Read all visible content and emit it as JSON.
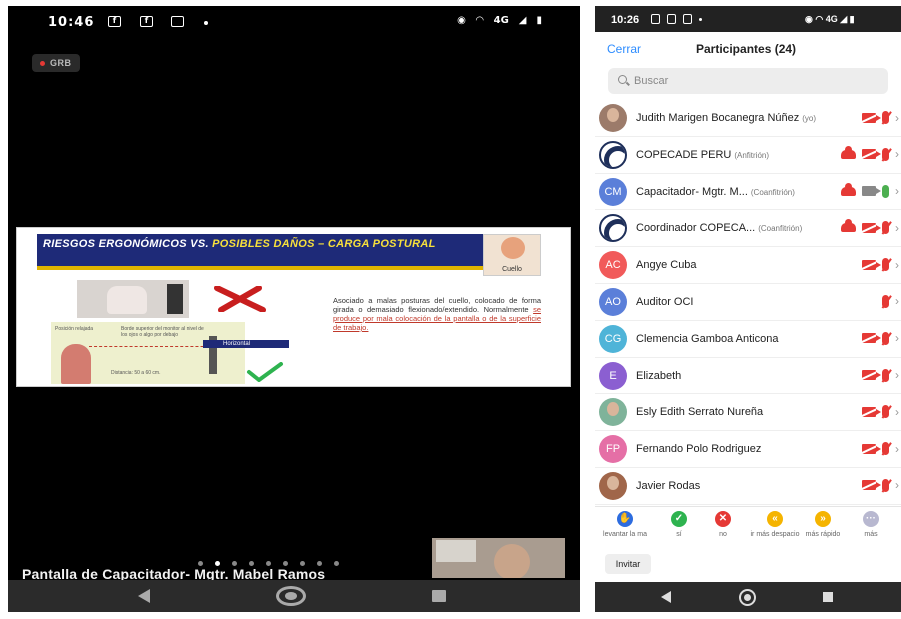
{
  "left_screen": {
    "status_bar": {
      "time": "10:46",
      "indicators": "4G"
    },
    "recording_badge": "GRB",
    "slide": {
      "title_part1": "RIESGOS ERGONÓMICOS VS. ",
      "title_part2": "POSIBLES DAÑOS – CARGA POSTURAL",
      "neck_label": "Cuello",
      "horizontal_label": "Horizontal",
      "distance_label": "Distancia: 50 a 60 cm.",
      "posicion_label": "Posición relajada",
      "borde_label": "Borde superior del monitor al nivel de los ojos o algo por debajo",
      "body_text": "Asociado a malas posturas del cuello, colocado de forma girada o demasiado flexionado/extendido. Normalmente ",
      "body_text_underlined": "se produce por mala colocación de la pantalla o de la superficie de trabajo."
    },
    "page_indicator_count": 9,
    "page_indicator_active": 2,
    "sharer_label": "Pantalla de Capacitador- Mgtr. Mabel Ramos"
  },
  "right_screen": {
    "status_bar": {
      "time": "10:26",
      "indicators": "4G"
    },
    "header": {
      "close_label": "Cerrar",
      "title": "Participantes (24)"
    },
    "search": {
      "placeholder": "Buscar"
    },
    "participants": [
      {
        "name": "Judith Marigen Bocanegra Núñez",
        "role": "(yo)",
        "avatar": "",
        "avatar_type": "photo",
        "color": "#9c7b6a",
        "cloud": false,
        "video": "off",
        "mic": "off"
      },
      {
        "name": "COPECADE PERU",
        "role": "(Anfitrión)",
        "avatar": "",
        "avatar_type": "logo",
        "color": "#ffffff",
        "cloud": true,
        "video": "off",
        "mic": "off"
      },
      {
        "name": "Capacitador- Mgtr. M...",
        "role": "(Coanfitrión)",
        "avatar": "CM",
        "avatar_type": "initials",
        "color": "#5b7fd9",
        "cloud": true,
        "video": "on",
        "mic": "on"
      },
      {
        "name": "Coordinador COPECA...",
        "role": "(Coanfitrión)",
        "avatar": "",
        "avatar_type": "logo",
        "color": "#ffffff",
        "cloud": true,
        "video": "off",
        "mic": "off"
      },
      {
        "name": "Angye Cuba",
        "role": "",
        "avatar": "AC",
        "avatar_type": "initials",
        "color": "#f15a5a",
        "cloud": false,
        "video": "off",
        "mic": "off"
      },
      {
        "name": "Auditor OCI",
        "role": "",
        "avatar": "AO",
        "avatar_type": "initials",
        "color": "#5b7fd9",
        "cloud": false,
        "video": "none",
        "mic": "off"
      },
      {
        "name": "Clemencia Gamboa Anticona",
        "role": "",
        "avatar": "CG",
        "avatar_type": "initials",
        "color": "#4fb4d8",
        "cloud": false,
        "video": "off",
        "mic": "off"
      },
      {
        "name": "Elizabeth",
        "role": "",
        "avatar": "E",
        "avatar_type": "initials",
        "color": "#8b5fd1",
        "cloud": false,
        "video": "off",
        "mic": "off"
      },
      {
        "name": "Esly Edith Serrato Nureña",
        "role": "",
        "avatar": "",
        "avatar_type": "photo",
        "color": "#7fb39a",
        "cloud": false,
        "video": "off",
        "mic": "off"
      },
      {
        "name": "Fernando Polo Rodriguez",
        "role": "",
        "avatar": "FP",
        "avatar_type": "initials",
        "color": "#e56fa6",
        "cloud": false,
        "video": "off",
        "mic": "off"
      },
      {
        "name": "Javier Rodas",
        "role": "",
        "avatar": "",
        "avatar_type": "photo",
        "color": "#a0664a",
        "cloud": false,
        "video": "off",
        "mic": "off"
      }
    ],
    "reactions": [
      {
        "label": "levantar la ma",
        "glyph": "✋",
        "color": "#2d6cdf"
      },
      {
        "label": "sí",
        "glyph": "✓",
        "color": "#2eb34f"
      },
      {
        "label": "no",
        "glyph": "✕",
        "color": "#e53935"
      },
      {
        "label": "ir más despacio",
        "glyph": "«",
        "color": "#f5b400"
      },
      {
        "label": "más rápido",
        "glyph": "»",
        "color": "#f5b400"
      },
      {
        "label": "más",
        "glyph": "···",
        "color": "#b8b8d0"
      }
    ],
    "invite_label": "Invitar"
  }
}
